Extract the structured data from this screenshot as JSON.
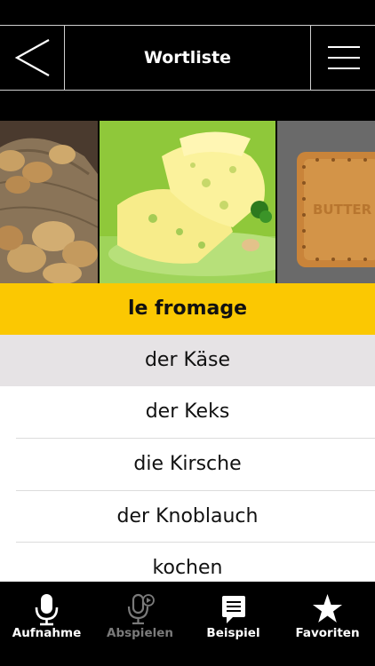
{
  "header": {
    "title": "Wortliste",
    "back_icon": "chevron-left-icon",
    "menu_icon": "hamburger-menu-icon"
  },
  "carousel": {
    "images": [
      {
        "subject": "potatoes-in-sack"
      },
      {
        "subject": "sliced-cheese"
      },
      {
        "subject": "butter-biscuit",
        "text": "BUTTER"
      }
    ]
  },
  "word_list": {
    "selected_translation": "le fromage",
    "items": [
      "der Käse",
      "der Keks",
      "die Kirsche",
      "der Knoblauch",
      "kochen"
    ]
  },
  "tab_bar": {
    "items": [
      {
        "label": "Aufnahme",
        "icon": "microphone-icon",
        "enabled": true
      },
      {
        "label": "Abspielen",
        "icon": "microphone-play-icon",
        "enabled": false
      },
      {
        "label": "Beispiel",
        "icon": "speech-bubble-icon",
        "enabled": true
      },
      {
        "label": "Favoriten",
        "icon": "star-icon",
        "enabled": true
      }
    ]
  },
  "colors": {
    "accent": "#fbc802",
    "highlight_row": "#e6e3e5",
    "background": "#000000"
  }
}
